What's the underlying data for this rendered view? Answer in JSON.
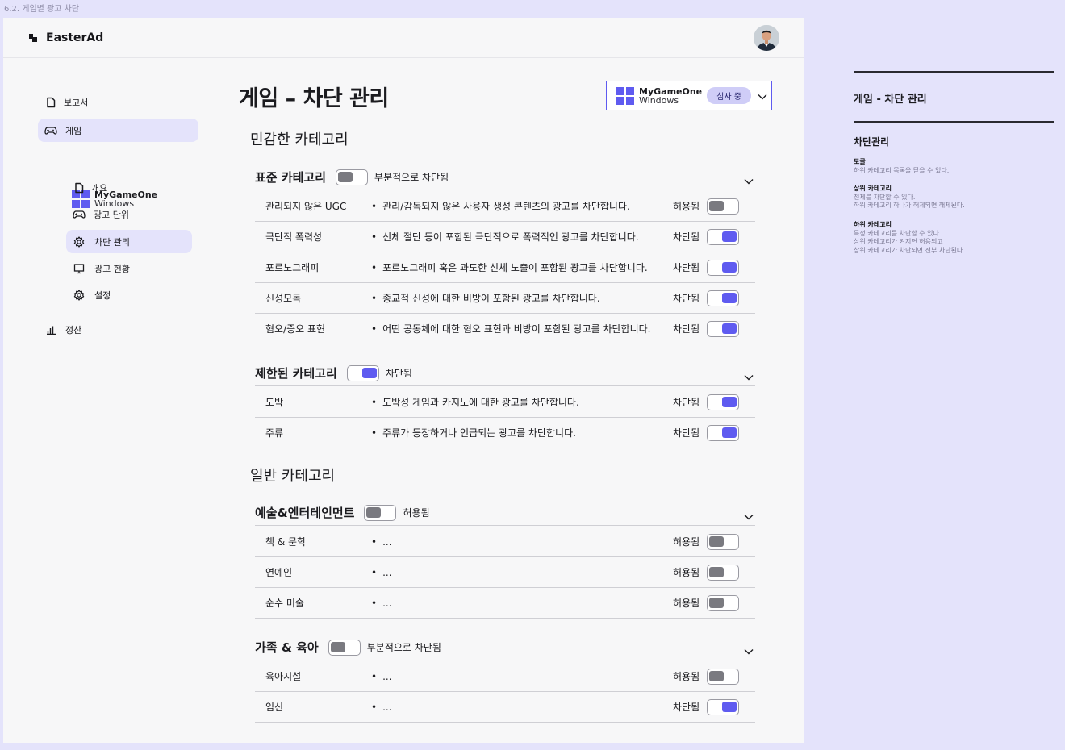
{
  "frame_label": "6.2. 게임별 광고 차단",
  "brand": {
    "name": "EasterAd"
  },
  "sidebar": {
    "items": [
      {
        "label": "보고서",
        "icon": "document-icon"
      },
      {
        "label": "게임",
        "icon": "gamepad-icon"
      },
      {
        "label": "개요",
        "icon": "document-icon"
      },
      {
        "label": "광고 단위",
        "icon": "gamepad-icon"
      },
      {
        "label": "차단 관리",
        "icon": "gear-icon"
      },
      {
        "label": "광고 현황",
        "icon": "monitor-icon"
      },
      {
        "label": "설정",
        "icon": "gear-icon"
      },
      {
        "label": "정산",
        "icon": "bar-chart-icon"
      }
    ],
    "game": {
      "name": "MyGameOne",
      "platform": "Windows"
    }
  },
  "main": {
    "title": "게임 – 차단 관리",
    "game_select": {
      "name": "MyGameOne",
      "platform": "Windows",
      "status": "심사 중"
    },
    "sensitive_title": "민감한 카테고리",
    "general_title": "일반 카테고리",
    "categories": [
      {
        "name": "표준 카테고리",
        "state": "부분적으로 차단됨",
        "on": false,
        "rows": [
          {
            "name": "관리되지 않은 UGC",
            "desc": "관리/감독되지 않은 사용자 생성 콘텐츠의 광고를 차단합니다.",
            "state": "허용됨",
            "on": false
          },
          {
            "name": "극단적 폭력성",
            "desc": "신체 절단 등이 포함된 극단적으로 폭력적인 광고를 차단합니다.",
            "state": "차단됨",
            "on": true
          },
          {
            "name": "포르노그래피",
            "desc": "포르노그래피 혹은 과도한 신체 노출이 포함된 광고를 차단합니다.",
            "state": "차단됨",
            "on": true
          },
          {
            "name": "신성모독",
            "desc": "종교적 신성에 대한 비방이 포함된 광고를 차단합니다.",
            "state": "차단됨",
            "on": true
          },
          {
            "name": "혐오/증오 표현",
            "desc": "어떤 공동체에 대한 혐오 표현과 비방이 포함된 광고를 차단합니다.",
            "state": "차단됨",
            "on": true
          }
        ]
      },
      {
        "name": "제한된 카테고리",
        "state": "차단됨",
        "on": true,
        "rows": [
          {
            "name": "도박",
            "desc": "도박성 게임과 카지노에 대한 광고를 차단합니다.",
            "state": "차단됨",
            "on": true
          },
          {
            "name": "주류",
            "desc": "주류가 등장하거나 언급되는 광고를 차단합니다.",
            "state": "차단됨",
            "on": true
          }
        ]
      },
      {
        "name": "예술&엔터테인먼트",
        "state": "허용됨",
        "on": false,
        "rows": [
          {
            "name": "책 & 문학",
            "desc": "...",
            "state": "허용됨",
            "on": false
          },
          {
            "name": "연예인",
            "desc": "...",
            "state": "허용됨",
            "on": false
          },
          {
            "name": "순수 미술",
            "desc": "...",
            "state": "허용됨",
            "on": false
          }
        ]
      },
      {
        "name": "가족 & 육아",
        "state": "부분적으로 차단됨",
        "on": false,
        "rows": [
          {
            "name": "육아시설",
            "desc": "...",
            "state": "허용됨",
            "on": false
          },
          {
            "name": "임신",
            "desc": "...",
            "state": "차단됨",
            "on": true
          }
        ]
      }
    ]
  },
  "notes": {
    "title": "게임 - 차단 관리",
    "subtitle": "차단관리",
    "items": [
      {
        "head": "토글",
        "lines": [
          "하위 카테고리 목록을 닫을 수 있다."
        ]
      },
      {
        "head": "상위 카테고리",
        "lines": [
          "전체를 차단할 수 있다.",
          "하위 카테고리 하나가 해제되면 해제된다."
        ]
      },
      {
        "head": "하위 카테고리",
        "lines": [
          "특정 카테고리를 차단할 수 있다.",
          "상위 카테고리가 켜지면 허용되고",
          "상위 카테고리가 차단되면 전부 차단된다"
        ]
      }
    ]
  },
  "colors": {
    "accent": "#5f5bf0",
    "active_bg": "#e4e3fb",
    "toggle_off": "#7a7a80"
  }
}
